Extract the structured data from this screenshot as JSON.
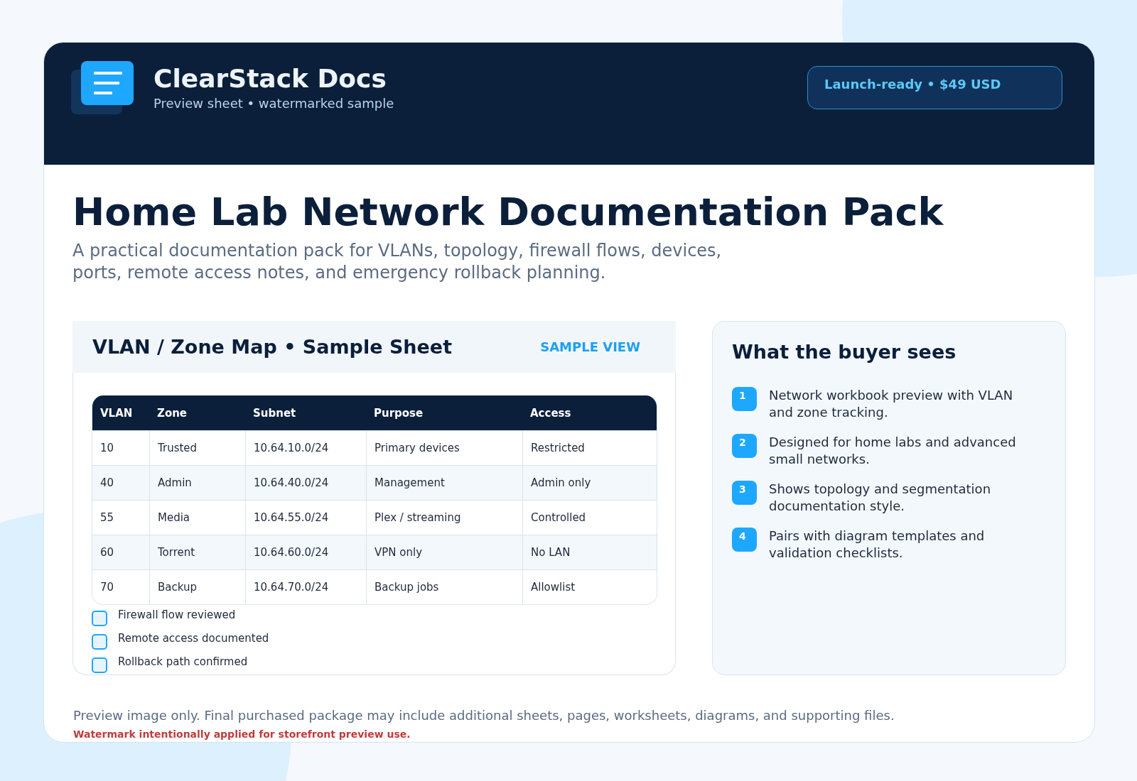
{
  "brand": {
    "name": "ClearStack Docs",
    "tagline": "Preview sheet • watermarked sample"
  },
  "badge": {
    "label": "Launch-ready • $49 USD"
  },
  "hero": {
    "title": "Home Lab Network Documentation Pack",
    "subtitle": "A practical documentation pack for VLANs, topology, firewall flows, devices, ports, remote access notes, and emergency rollback planning."
  },
  "sample_sheet": {
    "title": "VLAN / Zone Map • Sample Sheet",
    "tag": "SAMPLE VIEW",
    "table": {
      "columns": [
        "VLAN",
        "Zone",
        "Subnet",
        "Purpose",
        "Access"
      ],
      "rows": [
        [
          "10",
          "Trusted",
          "10.64.10.0/24",
          "Primary devices",
          "Restricted"
        ],
        [
          "40",
          "Admin",
          "10.64.40.0/24",
          "Management",
          "Admin only"
        ],
        [
          "55",
          "Media",
          "10.64.55.0/24",
          "Plex / streaming",
          "Controlled"
        ],
        [
          "60",
          "Torrent",
          "10.64.60.0/24",
          "VPN only",
          "No LAN"
        ],
        [
          "70",
          "Backup",
          "10.64.70.0/24",
          "Backup jobs",
          "Allowlist"
        ]
      ]
    },
    "checklist": [
      {
        "label": "Firewall flow reviewed",
        "checked": false
      },
      {
        "label": "Remote access documented",
        "checked": false
      },
      {
        "label": "Rollback path confirmed",
        "checked": false
      }
    ]
  },
  "buyer_panel": {
    "title": "What the buyer sees",
    "items": [
      {
        "number": "1",
        "text": "Network workbook preview with VLAN and zone tracking."
      },
      {
        "number": "2",
        "text": "Designed for home labs and advanced small networks."
      },
      {
        "number": "3",
        "text": "Shows topology and segmentation documentation style."
      },
      {
        "number": "4",
        "text": "Pairs with diagram templates and validation checklists."
      }
    ]
  },
  "footer": {
    "note": "Preview image only. Final purchased package may include additional sheets, pages, worksheets, diagrams, and supporting files.",
    "warning": "Watermark intentionally applied for storefront preview use."
  }
}
